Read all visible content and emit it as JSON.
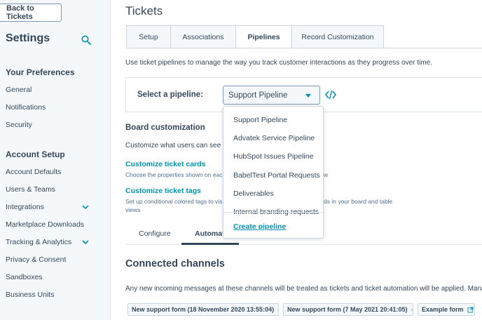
{
  "sidebar": {
    "back_label": "Back to Tickets",
    "title": "Settings",
    "search_icon": "search-icon",
    "sections": {
      "preferences": "Your Preferences",
      "account_setup": "Account Setup"
    },
    "pref_items": [
      "General",
      "Notifications",
      "Security"
    ],
    "account_items": [
      "Account Defaults",
      "Users & Teams",
      "Integrations",
      "Marketplace Downloads",
      "Tracking & Analytics",
      "Privacy & Consent",
      "Sandboxes",
      "Business Units"
    ]
  },
  "main": {
    "title": "Tickets",
    "tabs": [
      {
        "label": "Setup"
      },
      {
        "label": "Associations"
      },
      {
        "label": "Pipelines"
      },
      {
        "label": "Record Customization"
      }
    ],
    "intro": "Use ticket pipelines to manage the way you track customer interactions as they progress over time.",
    "pipeline_label": "Select a pipeline:",
    "pipeline_selected": "Support Pipeline",
    "board_heading": "Board customization",
    "board_sub": "Customize what users can see w",
    "cards_link": "Customize ticket cards",
    "cards_desc_left": "Choose the properties shown on each",
    "cards_desc_right": "w",
    "tags_link": "Customize ticket tags",
    "tags_desc_left": "Set up conditional colored tags to vis",
    "tags_desc_right": "ds in your board and table",
    "tags_desc_line2": "views",
    "subtabs": [
      "Configure",
      "Automat"
    ],
    "connected_heading": "Connected channels",
    "connected_sub": "Any new incoming messages at these channels will be treated as tickets and ticket automation will be applied. Mana",
    "channels": [
      "New support form (18 November 2020 13:55:04)",
      "New support form (7 May 2021 20:41:05)",
      "Example form"
    ]
  },
  "dropdown": {
    "options": [
      "Support Pipeline",
      "Advatek Service Pipeline",
      "HubSpot Issues Pipeline",
      "BabelTest Portal Requests",
      "Deliverables",
      "Internal branding requests"
    ],
    "create_label": "Create pipeline"
  },
  "colors": {
    "accent": "#0091ae",
    "text": "#33475b",
    "sidebar_bg": "#f5f8fa"
  }
}
